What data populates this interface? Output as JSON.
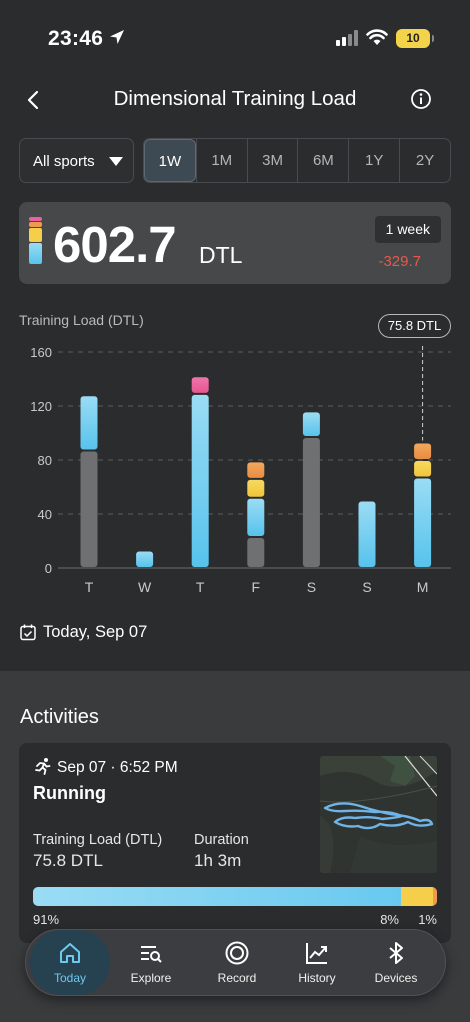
{
  "status_bar": {
    "time": "23:46",
    "battery": "10"
  },
  "header": {
    "title": "Dimensional Training Load"
  },
  "filter": {
    "sport": "All sports",
    "periods": [
      "1W",
      "1M",
      "3M",
      "6M",
      "1Y",
      "2Y"
    ],
    "active_period": "1W"
  },
  "summary": {
    "value": "602.7",
    "unit": "DTL",
    "range_label": "1 week",
    "delta": "-329.7"
  },
  "colors": {
    "gray": "#6f7072",
    "blue_top": "#9adcf4",
    "blue_bottom": "#57c3ec",
    "yellow": "#f5ce4a",
    "orange": "#ee9b4f",
    "pink": "#e9619e",
    "negative": "#e25a4e",
    "active_nav": "#6fc8ee"
  },
  "chart_data": {
    "type": "bar",
    "ylabel": "Training Load (DTL)",
    "yticks": [
      160,
      120,
      80,
      40,
      0
    ],
    "ylim": [
      0,
      160
    ],
    "grid": true,
    "categories": [
      "T",
      "W",
      "T",
      "F",
      "S",
      "S",
      "M"
    ],
    "series": [
      {
        "color_key": "gray",
        "values": [
          87,
          0,
          0,
          23,
          97,
          0,
          0
        ]
      },
      {
        "color_key": "blue",
        "values": [
          41,
          13,
          129,
          29,
          19,
          50,
          67
        ]
      },
      {
        "color_key": "yellow",
        "values": [
          0,
          0,
          0,
          14,
          0,
          0,
          13
        ]
      },
      {
        "color_key": "orange",
        "values": [
          0,
          0,
          0,
          13,
          0,
          0,
          13
        ]
      },
      {
        "color_key": "pink",
        "values": [
          0,
          0,
          13,
          0,
          0,
          0,
          0
        ]
      }
    ],
    "highlight": {
      "category_index": 6,
      "label": "75.8 DTL"
    }
  },
  "date_label": "Today, Sep 07",
  "activities": {
    "heading": "Activities",
    "items": [
      {
        "date": "Sep 07 · 6:52 PM",
        "name": "Running",
        "load_label": "Training Load (DTL)",
        "load_value": "75.8 DTL",
        "duration_label": "Duration",
        "duration_value": "1h 3m",
        "distribution": [
          {
            "label": "91%",
            "fraction": 0.91,
            "color_key": "blue"
          },
          {
            "label": "8%",
            "fraction": 0.08,
            "color_key": "yellow"
          },
          {
            "label": "1%",
            "fraction": 0.01,
            "color_key": "orange"
          }
        ]
      }
    ]
  },
  "nav": {
    "items": [
      {
        "label": "Today",
        "icon": "home-icon",
        "active": true
      },
      {
        "label": "Explore",
        "icon": "explore-search-icon",
        "active": false
      },
      {
        "label": "Record",
        "icon": "record-icon",
        "active": false
      },
      {
        "label": "History",
        "icon": "history-chart-icon",
        "active": false
      },
      {
        "label": "Devices",
        "icon": "bluetooth-icon",
        "active": false
      }
    ]
  }
}
